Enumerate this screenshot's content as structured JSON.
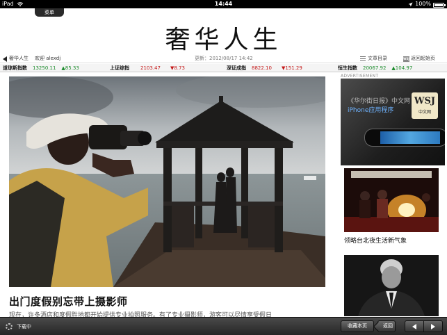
{
  "status_bar": {
    "device": "iPad",
    "time": "14:44",
    "battery": "100%",
    "battery_level": 1.0
  },
  "menu": {
    "label": "菜单"
  },
  "masthead": {
    "title": "奢华人生"
  },
  "navbar": {
    "back_label": "奢华人生",
    "welcome": "欢迎 alexdj",
    "updated": "更新：2012/08/17 14:42",
    "toc_label": "文章目录",
    "home_icon_text": "WSJ",
    "home_label": "返回起始页"
  },
  "ticker": [
    {
      "name": "道琼斯指数",
      "value": "13250.11",
      "change": "▲85.33",
      "dir": "up"
    },
    {
      "name": "上证综指",
      "value": "2103.47",
      "change": "▼8.73",
      "dir": "down"
    },
    {
      "name": "深证成指",
      "value": "8822.10",
      "change": "▼151.29",
      "dir": "down"
    },
    {
      "name": "恒生指数",
      "value": "20067.92",
      "change": "▲104.97",
      "dir": "up"
    }
  ],
  "article": {
    "headline": "出门度假别忘带上摄影师",
    "lede": "现在，许多酒店和度假胜地都开始提供专业拍照服务。有了专业摄影师，游客可以尽情享受假日"
  },
  "sidebar": {
    "ad_label": "ADVERTISEMENT",
    "ad_line1": "《华尔街日报》中文网",
    "ad_line2": "iPhone应用程序",
    "ad_logo": "WSJ",
    "ad_logo_sub": "中文网",
    "thumb1_caption": "领略台北夜生活新气象"
  },
  "toolbar": {
    "loading_text": "下载中",
    "save_label": "收藏本页",
    "back_label": "返回"
  }
}
